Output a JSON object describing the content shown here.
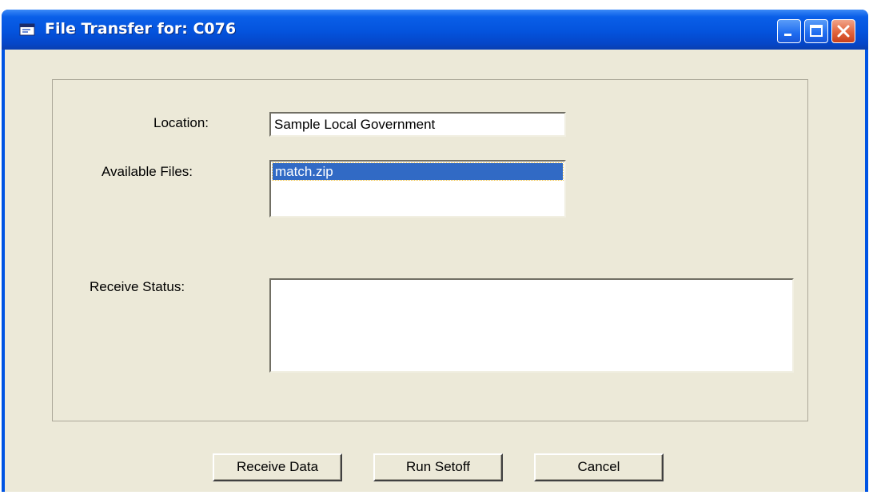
{
  "window": {
    "title": "File Transfer for: C076"
  },
  "form": {
    "location_label": "Location:",
    "location_value": "Sample Local Government",
    "files_label": "Available Files:",
    "files": [
      {
        "name": "match.zip",
        "selected": true
      }
    ],
    "status_label": "Receive Status:",
    "status_value": ""
  },
  "buttons": {
    "receive": "Receive Data",
    "setoff": "Run Setoff",
    "cancel": "Cancel"
  },
  "colors": {
    "titlebar": "#0453dd",
    "client_bg": "#ece9d8",
    "selection": "#316ac5",
    "close_button": "#e2643c"
  }
}
